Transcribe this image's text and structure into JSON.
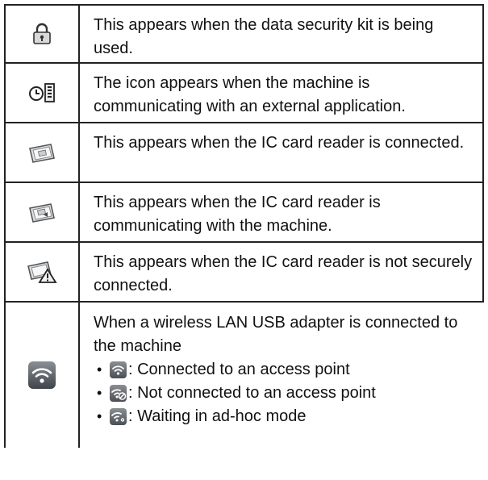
{
  "rows": [
    {
      "icon": "padlock-icon",
      "text": "This appears when the data security kit is being used."
    },
    {
      "icon": "external-app-communication-icon",
      "text": "The icon appears when the machine is communicating with an external application."
    },
    {
      "icon": "ic-card-reader-connected-icon",
      "text": "This appears when the IC card reader is connected."
    },
    {
      "icon": "ic-card-reader-communicating-icon",
      "text": "This appears when the IC card reader is communicating with the machine."
    },
    {
      "icon": "ic-card-reader-warning-icon",
      "text": "This appears when the IC card reader is not securely connected."
    },
    {
      "icon": "wireless-lan-icon",
      "text": "When a wireless LAN USB adapter is connected to the machine"
    }
  ],
  "wireless_bullets": [
    {
      "icon": "wifi-connected-icon",
      "text": ": Connected to an access point"
    },
    {
      "icon": "wifi-not-connected-icon",
      "text": ": Not connected to an access point"
    },
    {
      "icon": "wifi-adhoc-icon",
      "text": ": Waiting in ad-hoc mode"
    }
  ],
  "bullet_char": "•"
}
